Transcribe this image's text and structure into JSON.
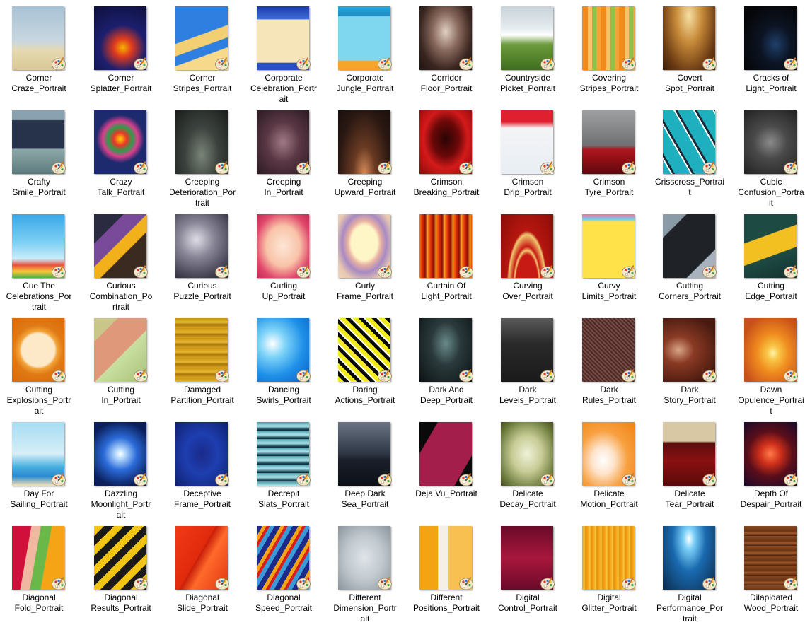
{
  "items": [
    {
      "l1": "Corner",
      "l2": "Craze_Portrait",
      "l3": "",
      "bg": "linear-gradient(180deg,#a8c2d6 0%,#c9d7df 55%,#e6d8b0 70%,#d9c896 100%)"
    },
    {
      "l1": "Corner",
      "l2": "Splatter_Portrait",
      "l3": "",
      "bg": "radial-gradient(circle at 55% 65%,#f6b400 0%,#e03a1e 18%,#1c1f6e 45%,#0d0f3a 100%)"
    },
    {
      "l1": "Corner",
      "l2": "Stripes_Portrait",
      "l3": "",
      "bg": "linear-gradient(160deg,#2f7fe0 0%,#2f7fe0 45%,#f2cf73 46%,#f2cf73 60%,#2f7fe0 61%,#2f7fe0 72%,#f6d98a 73%,#f6d98a 100%)"
    },
    {
      "l1": "Corporate",
      "l2": "Celebration_Portr",
      "l3": "ait",
      "bg": "linear-gradient(180deg,#1b3aa8 0%,#3d6fd8 20%,#f6e5b8 21%,#f6e5b8 88%,#2a4fc0 89%,#2a4fc0 100%)"
    },
    {
      "l1": "Corporate",
      "l2": "Jungle_Portrait",
      "l3": "",
      "bg": "linear-gradient(180deg,#2aa7d8 0%,#1e8cc4 15%,#7fd6ef 16%,#7fd6ef 85%,#f4a52a 86%,#f4a52a 100%)"
    },
    {
      "l1": "Corridor",
      "l2": "Floor_Portrait",
      "l3": "",
      "bg": "radial-gradient(ellipse at 50% 40%,#e2cfc3 0%,#8a6a5e 35%,#3a2620 70%,#1e1210 100%)"
    },
    {
      "l1": "Countryside",
      "l2": "Picket_Portrait",
      "l3": "",
      "bg": "linear-gradient(180deg,#c8d3da 0%,#e6ecef 35%,#ffffff 45%,#6c9a3c 60%,#3f6e20 100%)"
    },
    {
      "l1": "Covering",
      "l2": "Stripes_Portrait",
      "l3": "",
      "bg": "repeating-linear-gradient(90deg,#f28a1a 0px,#f28a1a 8px,#f6c36a 8px,#f6c36a 14px,#8fc14b 14px,#8fc14b 20px,#f4a33a 20px,#f4a33a 26px)"
    },
    {
      "l1": "Covert",
      "l2": "Spot_Portrait",
      "l3": "",
      "bg": "radial-gradient(ellipse at 50% 15%,#f6dfa3 0%,#c88b3a 35%,#6b3a12 75%,#3b1e08 100%)"
    },
    {
      "l1": "Cracks of",
      "l2": "Light_Portrait",
      "l3": "",
      "bg": "radial-gradient(ellipse at 60% 60%,#1f3f6a 0%,#0c1424 35%,#050608 80%)"
    },
    {
      "l1": "Crafty",
      "l2": "Smile_Portrait",
      "l3": "",
      "bg": "linear-gradient(180deg,#8aa2b0 0%,#8aa2b0 15%,#26334a 16%,#26334a 60%,#8da8a8 61%,#5d7b7d 100%)"
    },
    {
      "l1": "Crazy",
      "l2": "Talk_Portrait",
      "l3": "",
      "bg": "radial-gradient(circle at 50% 45%,#ffd200 0%,#e8362a 15%,#2f9c4c 28%,#d83f8c 40%,#1e2a6e 55%,#1e2a6e 100%)"
    },
    {
      "l1": "Creeping",
      "l2": "Deterioration_Por",
      "l3": "trait",
      "bg": "radial-gradient(ellipse at 50% 70%,#7a8478 0%,#3c433e 45%,#1a1d1b 100%)"
    },
    {
      "l1": "Creeping",
      "l2": "In_Portrait",
      "l3": "",
      "bg": "radial-gradient(ellipse at 50% 50%,#a07a86 0%,#5a3744 45%,#2a1a22 100%)"
    },
    {
      "l1": "Creeping",
      "l2": "Upward_Portrait",
      "l3": "",
      "bg": "radial-gradient(ellipse at 50% 100%,#d48c5a 0%,#6a3a22 30%,#2a1812 70%,#1a0f0c 100%)"
    },
    {
      "l1": "Crimson",
      "l2": "Breaking_Portrait",
      "l3": "",
      "bg": "radial-gradient(ellipse at 50% 45%,#2a0404 0%,#6b0808 35%,#d41a1a 60%,#8a0a0a 100%)"
    },
    {
      "l1": "Crimson",
      "l2": "Drip_Portrait",
      "l3": "",
      "bg": "linear-gradient(180deg,#e02030 0%,#e02030 18%,#f4f4f6 28%,#e8eef4 100%)"
    },
    {
      "l1": "Crimson",
      "l2": "Tyre_Portrait",
      "l3": "",
      "bg": "linear-gradient(180deg,#9ea0a2 0%,#6e7072 55%,#b0151e 62%,#8a0e14 80%,#5a0a0e 100%)"
    },
    {
      "l1": "Crisscross_Portrai",
      "l2": "t",
      "l3": "",
      "bg": "repeating-linear-gradient(60deg,#1fb0c0 0px,#1fb0c0 10px,#ffffff 10px,#ffffff 12px,#1c2a38 12px,#1c2a38 15px,#1fb0c0 15px,#1fb0c0 24px)"
    },
    {
      "l1": "Cubic",
      "l2": "Confusion_Portra",
      "l3": "it",
      "bg": "radial-gradient(circle at 50% 50%,#8a8a8a 0%,#4a4a4a 40%,#222222 100%)"
    },
    {
      "l1": "Cue The",
      "l2": "Celebrations_Por",
      "l3": "trait",
      "bg": "linear-gradient(180deg,#3aa7e8 0%,#7fd0f4 45%,#c9ecfa 70%,#e94f3c 80%,#f7c53a 90%,#4fb04a 100%)"
    },
    {
      "l1": "Curious",
      "l2": "Combination_Po",
      "l3": "rtrait",
      "bg": "linear-gradient(135deg,#2a2a40 0%,#2a2a40 25%,#7a4a9a 26%,#7a4a9a 45%,#f2b01a 46%,#f2b01a 60%,#3a2a20 61%,#3a2a20 100%)"
    },
    {
      "l1": "Curious",
      "l2": "Puzzle_Portrait",
      "l3": "",
      "bg": "radial-gradient(circle at 40% 40%,#dedde6 0%,#8a8898 35%,#3e3c4c 80%,#2a2832 100%)"
    },
    {
      "l1": "Curling",
      "l2": "Up_Portrait",
      "l3": "",
      "bg": "radial-gradient(ellipse at 50% 50%,#fde6d6 0%,#f9c3a8 45%,#e0476a 75%,#c02a56 100%)"
    },
    {
      "l1": "Curly",
      "l2": "Frame_Portrait",
      "l3": "",
      "bg": "radial-gradient(ellipse at 50% 45%,#fff6c8 0%,#fff6c8 35%,#e7b0a2 45%,#a88ac4 60%,#e9c8b0 80%,#f0d6bc 100%)"
    },
    {
      "l1": "Curtain Of",
      "l2": "Light_Portrait",
      "l3": "",
      "bg": "repeating-linear-gradient(90deg,#ff7a14 0px,#d8300a 4px,#8a0e06 8px,#ffae2a 12px)"
    },
    {
      "l1": "Curving",
      "l2": "Over_Portrait",
      "l3": "",
      "bg": "radial-gradient(ellipse at 50% 110%,#c81a14 0%,#c81a14 30%,#f0c870 34%,#c81a14 38%,#f0c870 50%,#b5160f 54%,#8a0c08 100%)"
    },
    {
      "l1": "Curvy",
      "l2": "Limits_Portrait",
      "l3": "",
      "bg": "linear-gradient(180deg,#ff6a9a 0%,#6ad0f0 8%,#ffe14a 12%,#ffe14a 100%)"
    },
    {
      "l1": "Cutting",
      "l2": "Corners_Portrait",
      "l3": "",
      "bg": "linear-gradient(135deg,#8a9aa6 0%,#8a9aa6 20%,#1f2226 21%,#1f2226 75%,#a8b2bc 76%,#a8b2bc 100%)"
    },
    {
      "l1": "Cutting",
      "l2": "Edge_Portrait",
      "l3": "",
      "bg": "linear-gradient(160deg,#1e4a44 0%,#1e4a44 35%,#f2c020 36%,#f2c020 62%,#1e4a44 63%,#13312e 100%)"
    },
    {
      "l1": "Cutting",
      "l2": "Explosions_Portr",
      "l3": "ait",
      "bg": "radial-gradient(circle at 50% 50%,#fde8c8 0%,#fde8c8 40%,#f2a43a 46%,#e07a14 60%,#d96a0a 100%)"
    },
    {
      "l1": "Cutting",
      "l2": "In_Portrait",
      "l3": "",
      "bg": "linear-gradient(135deg,#c9c68a 0%,#c9c68a 20%,#e0987a 21%,#e0987a 55%,#c9e0a0 56%,#a8c07a 100%)"
    },
    {
      "l1": "Damaged",
      "l2": "Partition_Portrait",
      "l3": "",
      "bg": "repeating-linear-gradient(180deg,#c8920e 0px,#e8b832 6px,#a8760a 9px,#d8a420 14px)"
    },
    {
      "l1": "Dancing",
      "l2": "Swirls_Portrait",
      "l3": "",
      "bg": "radial-gradient(ellipse at 30% 40%,#ffffff 0%,#7fd4f8 25%,#1e90e8 60%,#0a5ec2 100%)"
    },
    {
      "l1": "Daring",
      "l2": "Actions_Portrait",
      "l3": "",
      "bg": "repeating-linear-gradient(45deg,#f2ec1a 0px,#f2ec1a 6px,#0a0a0a 6px,#0a0a0a 11px,#ffffff 11px,#ffffff 13px)"
    },
    {
      "l1": "Dark And",
      "l2": "Deep_Portrait",
      "l3": "",
      "bg": "radial-gradient(ellipse at 50% 40%,#6a8a8a 0%,#2a3a3c 40%,#0c1214 100%)"
    },
    {
      "l1": "Dark",
      "l2": "Levels_Portrait",
      "l3": "",
      "bg": "linear-gradient(180deg,#5a5a5a 0%,#2a2a2a 40%,#1a1a1a 100%)"
    },
    {
      "l1": "Dark",
      "l2": "Rules_Portrait",
      "l3": "",
      "bg": "repeating-linear-gradient(45deg,#7a4a44 0px,#7a4a44 2px,#4a2a26 2px,#4a2a26 4px)"
    },
    {
      "l1": "Dark",
      "l2": "Story_Portrait",
      "l3": "",
      "bg": "radial-gradient(ellipse at 30% 50%,#d8a488 0%,#8a3a24 30%,#4a1a10 80%)"
    },
    {
      "l1": "Dawn",
      "l2": "Opulence_Portrai",
      "l3": "t",
      "bg": "radial-gradient(ellipse at 55% 55%,#fff4a8 0%,#f8c444 15%,#ef8a1e 40%,#c8501a 80%)"
    },
    {
      "l1": "Day For",
      "l2": "Sailing_Portrait",
      "l3": "",
      "bg": "linear-gradient(180deg,#a8dcf2 0%,#d6eef8 50%,#4ab0e0 70%,#2a8ad0 85%,#f6e0b0 100%)"
    },
    {
      "l1": "Dazzling",
      "l2": "Moonlight_Portr",
      "l3": "ait",
      "bg": "radial-gradient(circle at 50% 50%,#ffffff 0%,#bfe0ff 10%,#2a6ad8 40%,#0a1e5a 80%)"
    },
    {
      "l1": "Deceptive",
      "l2": "Frame_Portrait",
      "l3": "",
      "bg": "radial-gradient(ellipse at 50% 50%,#1a2a8a 0%,#1e3eb0 45%,#0e2070 100%)"
    },
    {
      "l1": "Decrepit",
      "l2": "Slats_Portrait",
      "l3": "",
      "bg": "repeating-linear-gradient(180deg,#4a9aa8 0px,#aee4ec 6px,#1e4e5c 10px,#0c2a34 12px)"
    },
    {
      "l1": "Deep Dark",
      "l2": "Sea_Portrait",
      "l3": "",
      "bg": "linear-gradient(180deg,#6a7484 0%,#2e3644 50%,#1a1f2a 60%,#0c1016 100%)"
    },
    {
      "l1": "Deja Vu_Portrait",
      "l2": "",
      "l3": "",
      "bg": "linear-gradient(120deg,#0a0a0a 0%,#0a0a0a 20%,#a41e4c 21%,#a41e4c 80%,#0a0a0a 81%,#0a0a0a 100%)"
    },
    {
      "l1": "Delicate",
      "l2": "Decay_Portrait",
      "l3": "",
      "bg": "radial-gradient(ellipse at 50% 50%,#eef2d8 0%,#c8cc96 40%,#6a7a3a 80%,#4a4a20 100%)"
    },
    {
      "l1": "Delicate",
      "l2": "Motion_Portrait",
      "l3": "",
      "bg": "radial-gradient(ellipse at 40% 60%,#ffffff 0%,#fde4cc 25%,#f8a040 55%,#ef8210 100%)"
    },
    {
      "l1": "Delicate",
      "l2": "Tear_Portrait",
      "l3": "",
      "bg": "linear-gradient(180deg,#d8c8a4 0%,#d8c8a4 30%,#5a0e0e 33%,#8a1010 60%,#5a0a0a 100%)"
    },
    {
      "l1": "Depth Of",
      "l2": "Despair_Portrait",
      "l3": "",
      "bg": "radial-gradient(circle at 50% 50%,#ff7a4a 0%,#d0301a 25%,#5a0e1a 55%,#1a0a2a 100%)"
    },
    {
      "l1": "Diagonal",
      "l2": "Fold_Portrait",
      "l3": "",
      "bg": "linear-gradient(100deg,#d0103a 0%,#d0103a 30%,#f0b8a0 31%,#f0b8a0 45%,#6ab84a 46%,#6ab84a 62%,#f4a414 63%,#f4a414 100%)"
    },
    {
      "l1": "Diagonal",
      "l2": "Results_Portrait",
      "l3": "",
      "bg": "repeating-linear-gradient(135deg,#f2c414 0px,#f2c414 10px,#1a1a1a 10px,#1a1a1a 20px)"
    },
    {
      "l1": "Diagonal",
      "l2": "Slide_Portrait",
      "l3": "",
      "bg": "linear-gradient(120deg,#f23a14 0%,#e02a0c 45%,#c81e0a 46%,#ff6a2a 60%,#e03410 100%)"
    },
    {
      "l1": "Diagonal",
      "l2": "Speed_Portrait",
      "l3": "",
      "bg": "repeating-linear-gradient(120deg,#1e2a8a 0px,#1e2a8a 7px,#f2a414 7px,#f2a414 12px,#d81e1e 12px,#d81e1e 16px,#3a9ad8 16px,#3a9ad8 22px)"
    },
    {
      "l1": "Different",
      "l2": "Dimension_Portr",
      "l3": "ait",
      "bg": "radial-gradient(ellipse at 50% 50%,#dfe4e8 0%,#c0c8ce 50%,#8a949c 100%)"
    },
    {
      "l1": "Different",
      "l2": "Positions_Portrait",
      "l3": "",
      "bg": "linear-gradient(90deg,#f2a414 0%,#f2a414 35%,#f4f0e8 36%,#f4f0e8 55%,#f7c050 56%,#f7c050 100%)"
    },
    {
      "l1": "Digital",
      "l2": "Control_Portrait",
      "l3": "",
      "bg": "linear-gradient(180deg,#6a0a2a 0%,#a8163c 50%,#6a0a2a 100%)"
    },
    {
      "l1": "Digital",
      "l2": "Glitter_Portrait",
      "l3": "",
      "bg": "repeating-linear-gradient(90deg,#f4a814 0px,#f8c440 3px,#e88a0a 5px,#f4a814 8px)"
    },
    {
      "l1": "Digital",
      "l2": "Performance_Por",
      "l3": "trait",
      "bg": "radial-gradient(ellipse at 50% 20%,#ffffff 0%,#7ad0f8 15%,#1a6ab0 45%,#0a2a4a 100%)"
    },
    {
      "l1": "Dilapidated",
      "l2": "Wood_Portrait",
      "l3": "",
      "bg": "repeating-linear-gradient(180deg,#8a4a22 0px,#6a3414 7px,#a0582a 10px,#4a2410 14px)"
    }
  ]
}
